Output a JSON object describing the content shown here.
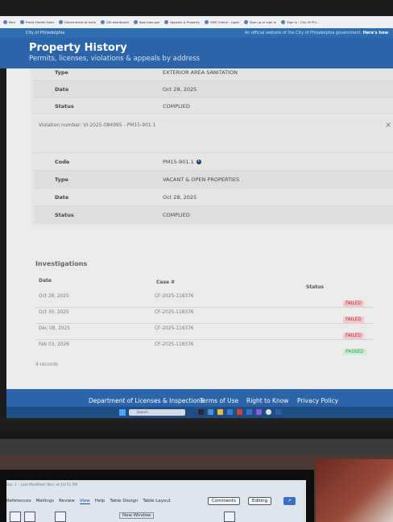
{
  "browser": {
    "bookmarks": [
      "Mail",
      "Public Health Data",
      "Government of India",
      "GIS dashboard",
      "New Jobs gov",
      "Appeals & Property",
      "GMS Online - Login",
      "Sign up or sign in",
      "Sign in - City Of Phi..."
    ]
  },
  "site": {
    "brand": "City of Philadelphia",
    "official_notice": "An official website of the City of Philadelphia government.",
    "official_link": "Here's how",
    "page_title": "Property History",
    "page_subtitle": "Permits, licenses, violations & appeals by address"
  },
  "violation_prev": {
    "type_label": "Type",
    "type_value": "EXTERIOR AREA SANITATION",
    "date_label": "Date",
    "date_value": "Oct 28, 2025",
    "status_label": "Status",
    "status_value": "COMPLIED"
  },
  "violation": {
    "header": "Violation number: VI-2025-084995 - PM15-901.1",
    "close_icon": "×",
    "code_label": "Code",
    "code_value": "PM15-901.1",
    "info_icon": "i",
    "type_label": "Type",
    "type_value": "VACANT & OPEN PROPERTIES",
    "date_label": "Date",
    "date_value": "Oct 28, 2025",
    "status_label": "Status",
    "status_value": "COMPLIED"
  },
  "investigations": {
    "title": "Investigations",
    "col_date": "Date",
    "col_case": "Case #",
    "col_status": "Status",
    "rows": [
      {
        "date": "Oct 28, 2025",
        "case": "CF-2025-118376",
        "status": "FAILED"
      },
      {
        "date": "Oct 30, 2025",
        "case": "CF-2025-118376",
        "status": "FAILED"
      },
      {
        "date": "Dec 08, 2025",
        "case": "CF-2025-118376",
        "status": "FAILED"
      },
      {
        "date": "Feb 03, 2026",
        "case": "CF-2025-118376",
        "status": "PASSED"
      }
    ],
    "records": "4 records"
  },
  "footer": {
    "dept": "Department of Licenses & Inspections",
    "terms": "Terms of Use",
    "right_to_know": "Right to Know",
    "privacy": "Privacy Policy"
  },
  "taskbar": {
    "search_placeholder": "Search"
  },
  "word": {
    "title": "Doc 1 - Last Modified: Mon at 10:51 PM",
    "menu": [
      "References",
      "Mailings",
      "Review",
      "View",
      "Help",
      "Table Design",
      "Table Layout"
    ],
    "comments": "Comments",
    "editing": "Editing",
    "new_window": "New Window"
  },
  "colors": {
    "header_blue": "#2b64a8",
    "failed_bg": "#f5c9cc",
    "failed_text": "#c0303a",
    "passed_bg": "#c8efd6",
    "passed_text": "#2f9c55"
  }
}
